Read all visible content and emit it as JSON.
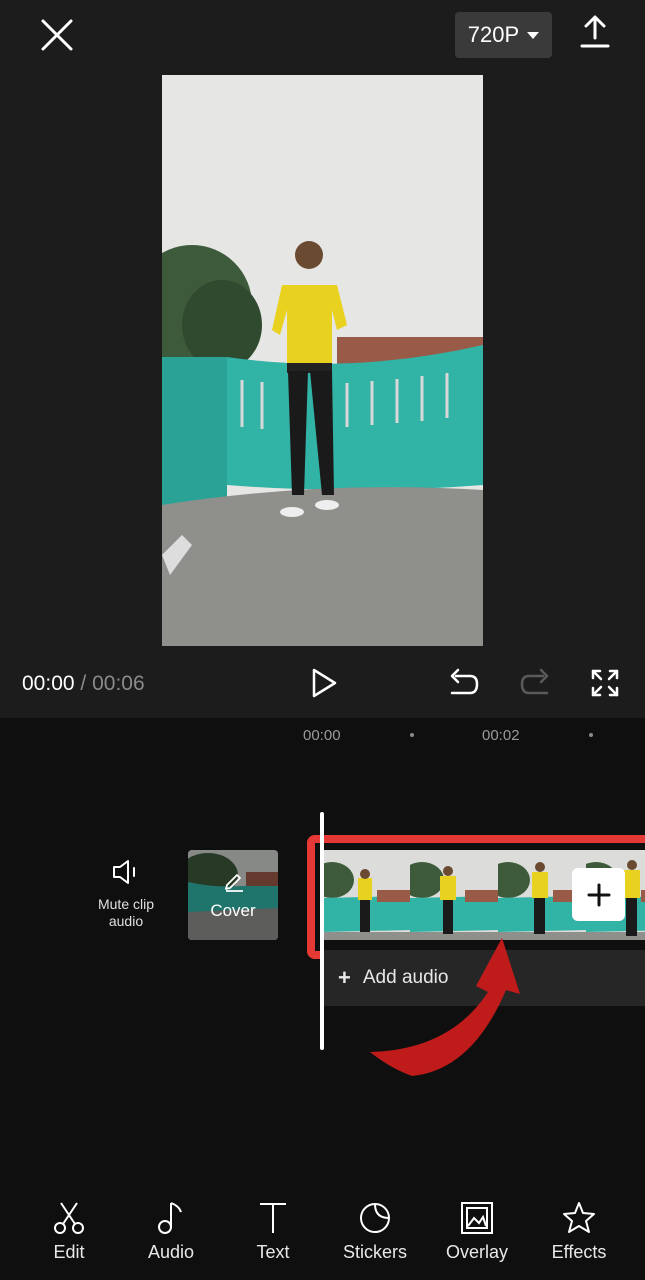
{
  "header": {
    "resolution_label": "720P",
    "close_icon": "close-icon",
    "export_icon": "upload-icon"
  },
  "player": {
    "current_time": "00:00",
    "separator": "/",
    "total_time": "00:06"
  },
  "ruler": {
    "labels": [
      "00:00",
      "00:02"
    ]
  },
  "timeline": {
    "mute_label_line1": "Mute clip",
    "mute_label_line2": "audio",
    "cover_label": "Cover",
    "add_audio_label": "Add audio",
    "highlight_color": "#e53935"
  },
  "toolbar": {
    "items": [
      {
        "label": "Edit",
        "icon": "scissors-icon"
      },
      {
        "label": "Audio",
        "icon": "music-note-icon"
      },
      {
        "label": "Text",
        "icon": "text-icon"
      },
      {
        "label": "Stickers",
        "icon": "sticker-icon"
      },
      {
        "label": "Overlay",
        "icon": "overlay-icon"
      },
      {
        "label": "Effects",
        "icon": "effects-star-icon"
      }
    ]
  }
}
